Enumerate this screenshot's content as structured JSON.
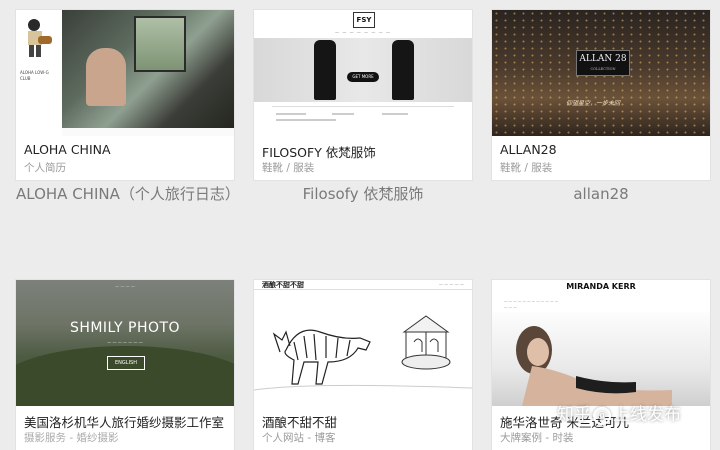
{
  "cards": [
    {
      "title": "ALOHA CHINA",
      "category": "个人简历",
      "caption": "ALOHA CHINA（个人旅行日志）",
      "thumb": {
        "side_text": "ALOHA LOW-G CLUB"
      }
    },
    {
      "title": "FILOSOFY 依梵服饰",
      "category": "鞋靴 / 服装",
      "caption": "Filosofy 依梵服饰",
      "thumb": {
        "logo": "FSY",
        "button": "GET MORE"
      }
    },
    {
      "title": "ALLAN28",
      "category": "鞋靴 / 服装",
      "caption": "allan28",
      "thumb": {
        "brand": "ALLAN 28",
        "brand_sub": "COLLECTION",
        "quote": "仰望星空，一步未回"
      }
    },
    {
      "title": "美国洛杉机华人旅行婚纱摄影工作室",
      "category": "摄影服务 - 婚纱摄影",
      "caption": "",
      "thumb": {
        "heading": "SHMILY PHOTO",
        "button": "ENGLISH"
      }
    },
    {
      "title": "酒酿不甜不甜",
      "category": "个人网站 - 博客",
      "caption": "",
      "thumb": {
        "heading": "酒酿不甜不甜"
      }
    },
    {
      "title": "施华洛世奇 米兰达可儿",
      "category": "大牌案例 - 时装",
      "caption": "",
      "thumb": {
        "heading": "MIRANDA KERR"
      }
    }
  ],
  "watermark": {
    "text_left": "知乎",
    "text_right": "上线发布"
  },
  "colors": {
    "page_bg": "#ececed",
    "caption": "#7a7a7a",
    "subtitle": "#9a9a9a"
  }
}
